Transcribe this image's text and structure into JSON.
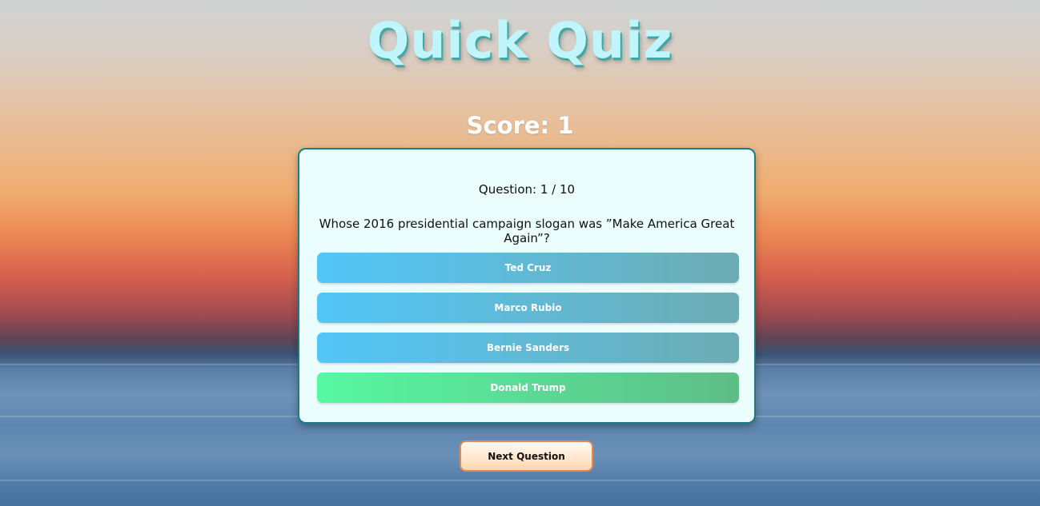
{
  "app": {
    "title": "Quick Quiz"
  },
  "score": {
    "label": "Score: 1",
    "value": 1
  },
  "question": {
    "counter": "Question: 1 / 10",
    "current": 1,
    "total": 10,
    "text": "Whose 2016 presidential campaign slogan was ”Make America Great Again”?"
  },
  "answers": [
    {
      "label": "Ted Cruz",
      "state": "neutral"
    },
    {
      "label": "Marco Rubio",
      "state": "neutral"
    },
    {
      "label": "Bernie Sanders",
      "state": "neutral"
    },
    {
      "label": "Donald Trump",
      "state": "correct"
    }
  ],
  "controls": {
    "next_label": "Next Question"
  },
  "colors": {
    "title": "#bff5fb",
    "card_bg": "#ecfdfd",
    "card_border": "#1b7c86",
    "answer_start": "#52c6f8",
    "answer_end": "#6eacb3",
    "correct_start": "#57f8a3",
    "correct_end": "#5ebd87",
    "next_border": "#e08a55"
  }
}
